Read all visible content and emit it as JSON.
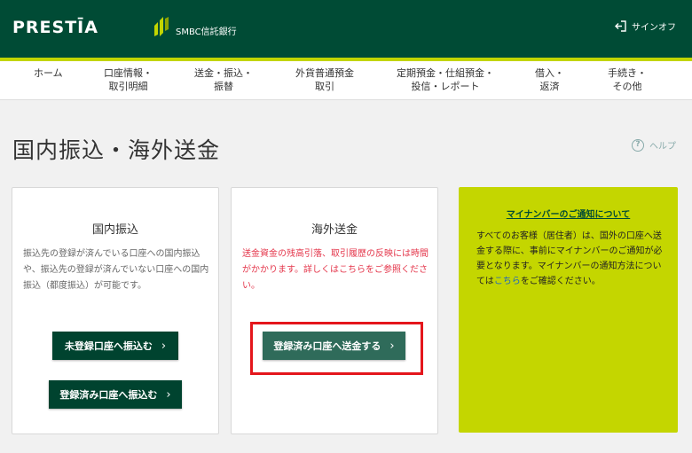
{
  "header": {
    "logo": "PRESTĪA",
    "bank_name": "SMBC信託銀行",
    "signout_label": "サインオフ"
  },
  "nav": {
    "items": [
      {
        "line1": "ホーム",
        "line2": ""
      },
      {
        "line1": "口座情報・",
        "line2": "取引明細"
      },
      {
        "line1": "送金・振込・",
        "line2": "振替"
      },
      {
        "line1": "外貨普通預金",
        "line2": "取引"
      },
      {
        "line1": "定期預金・仕組預金・",
        "line2": "投信・レポート"
      },
      {
        "line1": "借入・",
        "line2": "返済"
      },
      {
        "line1": "手続き・",
        "line2": "その他"
      }
    ]
  },
  "page": {
    "title": "国内振込・海外送金",
    "help_label": "ヘルプ"
  },
  "domestic": {
    "title": "国内振込",
    "description": "振込先の登録が済んでいる口座への国内振込や、振込先の登録が済んでいない口座への国内振込（都度振込）が可能です。",
    "btn_unregistered": "未登録口座へ振込む",
    "btn_registered": "登録済み口座へ振込む"
  },
  "overseas": {
    "title": "海外送金",
    "description_before": "送金資金の残高引落、取引履歴の反映には時間がかかります。詳しくは",
    "description_link": "こちら",
    "description_after": "をご参照ください。",
    "btn_registered": "登録済み口座へ送金する"
  },
  "notice": {
    "title": "マイナンバーのご通知について",
    "body_before": "すべてのお客様（居住者）は、国外の口座へ送金する際に、事前にマイナンバーのご通知が必要となります。マイナンバーの通知方法については",
    "body_link": "こちら",
    "body_after": "をご確認ください。"
  },
  "colors": {
    "header_bg": "#004b35",
    "accent": "#c4d600",
    "button_bg": "#00432f",
    "alert_red": "#e4364b",
    "highlight_red": "#e4161c"
  }
}
